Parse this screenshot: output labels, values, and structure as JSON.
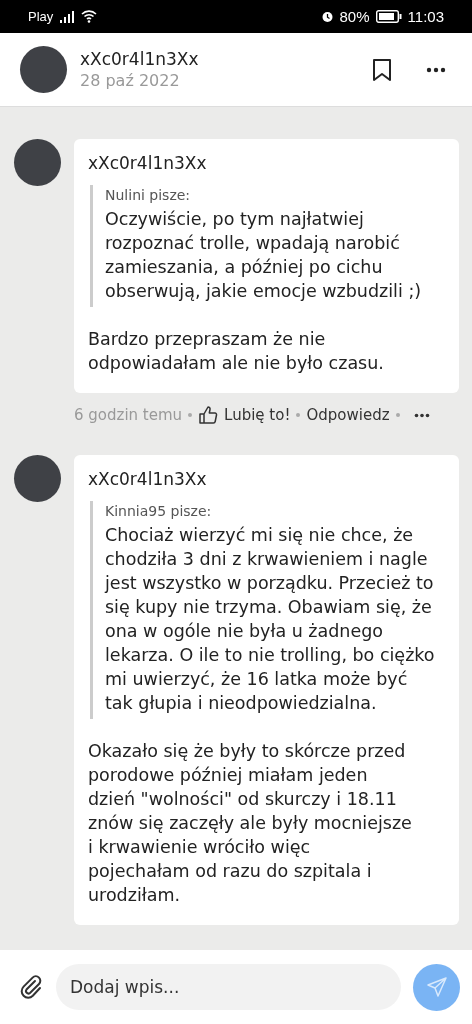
{
  "status_bar": {
    "carrier": "Play",
    "battery": "80%",
    "time": "11:03"
  },
  "post": {
    "author": "xXc0r4l1n3Xx",
    "date": "28 paź 2022"
  },
  "comments": [
    {
      "author": "xXc0r4l1n3Xx",
      "quote_author": "Nulini pisze:",
      "quote": "Oczywiście, po tym najłatwiej rozpoznać trolle, wpadają narobić zamieszania, a później po cichu obserwują, jakie emocje wzbudzili ;)",
      "text": "Bardzo przepraszam że nie odpowiadałam ale nie było czasu.",
      "footer": {
        "time": "6 godzin temu",
        "like": "Lubię to!",
        "reply": "Odpowiedz"
      }
    },
    {
      "author": "xXc0r4l1n3Xx",
      "quote_author": "Kinnia95 pisze:",
      "quote": "Chociaż wierzyć mi się nie chce, że chodziła 3 dni z krwawieniem i nagle jest wszystko w porządku. Przecież to się kupy nie trzyma. Obawiam się, że ona w ogóle nie była u żadnego lekarza. O ile to nie trolling, bo ciężko mi uwierzyć, że 16 latka może być tak głupia i nieodpowiedzialna.",
      "text": "Okazało się że były to skórcze przed porodowe później miałam jeden dzień \"wolności\" od skurczy i 18.11 znów się zaczęły ale były mocniejsze i krwawienie wróciło więc pojechałam od razu do szpitala i urodziłam."
    }
  ],
  "composer": {
    "placeholder": "Dodaj wpis..."
  }
}
